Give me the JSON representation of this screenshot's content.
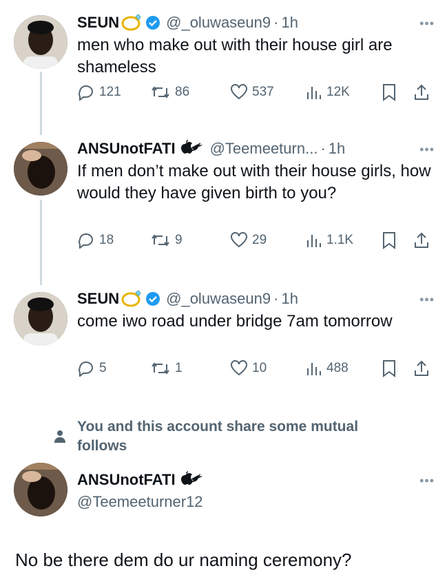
{
  "tweets": [
    {
      "name": "SEUN",
      "handle": "@_oluwaseun9",
      "time": "1h",
      "text": "men who make out with their house girl are shameless",
      "replies": "121",
      "retweets": "86",
      "likes": "537",
      "views": "12K"
    },
    {
      "name": "ANSUnotFATI",
      "name_suffix": "🐦",
      "handle": "@Teemeeturn...",
      "time": "1h",
      "text": "If men don’t make out with their house girls, how would they have given birth to you?",
      "replies": "18",
      "retweets": "9",
      "likes": "29",
      "views": "1.1K"
    },
    {
      "name": "SEUN",
      "handle": "@_oluwaseun9",
      "time": "1h",
      "text": "come iwo road under bridge 7am tomorrow",
      "replies": "5",
      "retweets": "1",
      "likes": "10",
      "views": "488"
    }
  ],
  "mutual_notice": "You and this account share some mutual follows",
  "reply_author": {
    "name": "ANSUnotFATI",
    "handle": "@Teemeeturner12"
  },
  "reply_text": "No be there dem do ur naming ceremony?",
  "separator_dot": "·",
  "more_glyph": "•••",
  "colors": {
    "accent": "#1d9bf0",
    "muted": "#536471",
    "line": "#cfd9de"
  }
}
